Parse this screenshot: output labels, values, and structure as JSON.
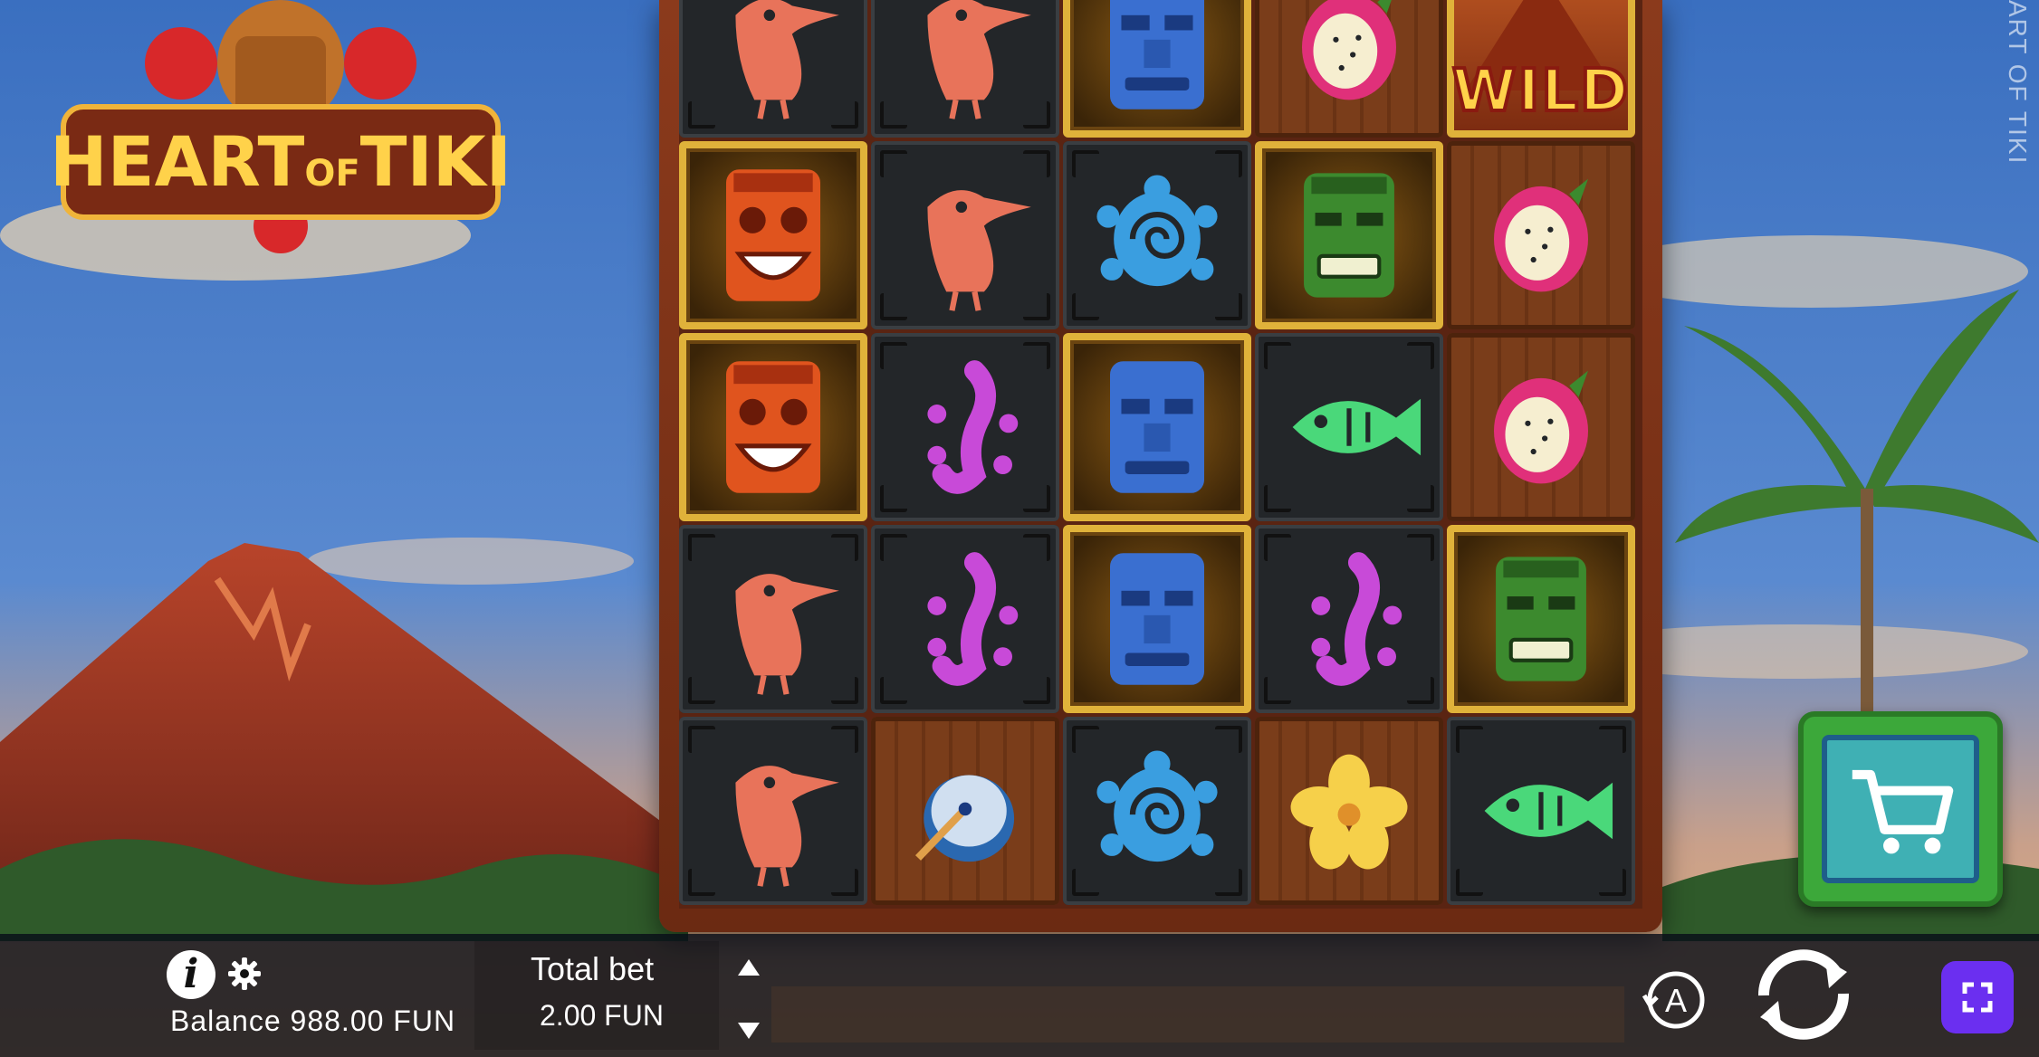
{
  "game": {
    "logo_text_main": "HEART",
    "logo_text_of": "OF",
    "logo_text_tiki": "TIKI",
    "side_label": "ART OF TIKI",
    "wild_label": "WILD"
  },
  "reels": {
    "grid": [
      [
        "toucan",
        "toucan",
        "blue-tiki",
        "dragonfruit",
        "wild-volcano"
      ],
      [
        "orange-tiki",
        "toucan",
        "turtle",
        "green-tiki",
        "dragonfruit"
      ],
      [
        "orange-tiki",
        "gecko",
        "blue-tiki",
        "fish",
        "dragonfruit"
      ],
      [
        "toucan",
        "gecko",
        "blue-tiki",
        "gecko",
        "green-tiki"
      ],
      [
        "toucan",
        "drum",
        "turtle",
        "plumeria",
        "fish"
      ]
    ]
  },
  "bottom_bar": {
    "balance_label": "Balance 988.00 FUN",
    "total_bet_label": "Total bet",
    "total_bet_value": "2.00 FUN",
    "auto_label": "A"
  },
  "colors": {
    "toucan": "#e8735a",
    "gecko": "#c84ad8",
    "turtle": "#3a9ee0",
    "fish": "#4ad87a",
    "fullscreen_button": "#6b2ff0",
    "cart_button": "#3ca83a"
  }
}
